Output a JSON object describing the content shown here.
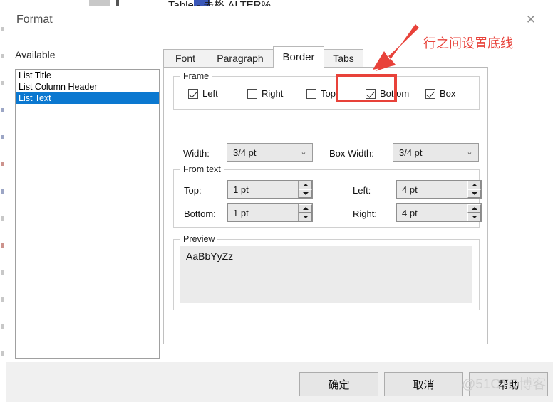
{
  "background": {
    "title_text": "Table - 表格 ALTER%",
    "rail_marks": [
      "dark",
      "dark",
      "dark",
      "blue",
      "blue",
      "red",
      "blue",
      "dark",
      "red",
      "dark",
      "dark",
      "dark",
      "dark"
    ]
  },
  "dialog": {
    "title": "Format",
    "close_icon": "✕"
  },
  "left_pane": {
    "label": "Available",
    "items": [
      {
        "label": "List Title",
        "selected": false
      },
      {
        "label": "List Column Header",
        "selected": false
      },
      {
        "label": "List Text",
        "selected": true
      }
    ]
  },
  "tabs": [
    {
      "label": "Font",
      "active": false
    },
    {
      "label": "Paragraph",
      "active": false
    },
    {
      "label": "Border",
      "active": true
    },
    {
      "label": "Tabs",
      "active": false
    }
  ],
  "frame_group": {
    "title": "Frame",
    "checkboxes": [
      {
        "label": "Left",
        "checked": true
      },
      {
        "label": "Right",
        "checked": false
      },
      {
        "label": "Top",
        "checked": false
      },
      {
        "label": "Bottom",
        "checked": true
      },
      {
        "label": "Box",
        "checked": true
      }
    ]
  },
  "width_row": {
    "width_label": "Width:",
    "width_value": "3/4 pt",
    "box_width_label": "Box Width:",
    "box_width_value": "3/4 pt",
    "chevron_icon": "⌄"
  },
  "from_text_group": {
    "title": "From text",
    "fields": [
      {
        "label": "Top:",
        "value": "1 pt"
      },
      {
        "label": "Bottom:",
        "value": "1 pt"
      },
      {
        "label": "Left:",
        "value": "4 pt"
      },
      {
        "label": "Right:",
        "value": "4 pt"
      }
    ]
  },
  "preview_group": {
    "title": "Preview",
    "sample_text": "AaBbYyZz"
  },
  "annotation": {
    "text": "行之间设置底线",
    "color": "#e8423a"
  },
  "footer": {
    "buttons": [
      {
        "label": "确定"
      },
      {
        "label": "取消"
      },
      {
        "label": "帮助"
      }
    ]
  },
  "watermark": {
    "text": "@51CTO博客"
  },
  "colors": {
    "selection_blue": "#0b78d0",
    "annotation_red": "#e8423a",
    "dialog_bg": "#f0f0f0"
  }
}
